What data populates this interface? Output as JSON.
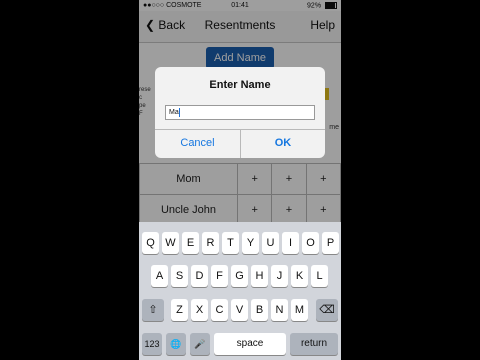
{
  "status": {
    "carrier": "●●○○○ COSMOTE",
    "time": "01:41",
    "battery": "92%"
  },
  "nav": {
    "back": "❮ Back",
    "title": "Resentments",
    "help": "Help"
  },
  "add_name_button": "Add Name",
  "behind": {
    "left_text": "rese\nc\npe\nF",
    "right_text": "me"
  },
  "rows": [
    {
      "name": "Mom",
      "cells": [
        "+",
        "+",
        "+"
      ]
    },
    {
      "name": "Uncle John",
      "cells": [
        "+",
        "+",
        "+"
      ]
    }
  ],
  "dialog": {
    "title": "Enter Name",
    "input_value": "Ma",
    "cancel": "Cancel",
    "ok": "OK"
  },
  "keyboard": {
    "row1": [
      "Q",
      "W",
      "E",
      "R",
      "T",
      "Y",
      "U",
      "I",
      "O",
      "P"
    ],
    "row2": [
      "A",
      "S",
      "D",
      "F",
      "G",
      "H",
      "J",
      "K",
      "L"
    ],
    "row3": [
      "Z",
      "X",
      "C",
      "V",
      "B",
      "N",
      "M"
    ],
    "shift": "⇧",
    "delete": "⌫",
    "numbers": "123",
    "globe": "🌐",
    "mic": "🎤",
    "space": "space",
    "return": "return"
  }
}
